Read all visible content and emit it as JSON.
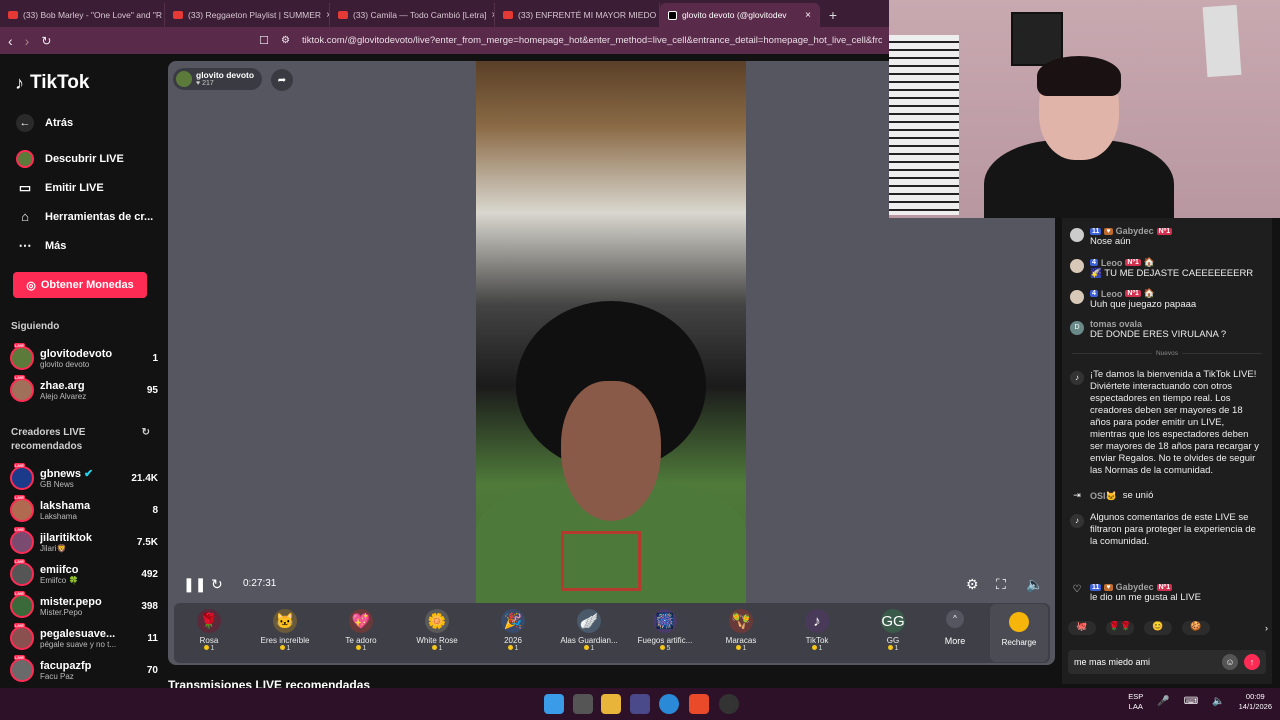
{
  "browser": {
    "tabs": [
      {
        "title": "(33) Bob Marley - \"One Love\" and \"R",
        "type": "youtube"
      },
      {
        "title": "(33) Reggaeton Playlist | SUMMER",
        "type": "youtube-muted"
      },
      {
        "title": "(33) Camila — Todo Cambió [Letra]",
        "type": "youtube"
      },
      {
        "title": "(33) ENFRENTÉ MI MAYOR MIEDO -",
        "type": "youtube"
      },
      {
        "title": "glovito devoto (@glovitodev",
        "type": "tiktok",
        "active": true
      }
    ],
    "url": "tiktok.com/@glovitodevoto/live?enter_from_merge=homepage_hot&enter_method=live_cell&entrance_detail=homepage_hot_live_cell&from"
  },
  "sidebar": {
    "brand": "TikTok",
    "nav": [
      {
        "label": "Atrás",
        "icon": "back-arrow-icon"
      },
      {
        "label": "Descubrir LIVE",
        "icon": "live-avatar-icon"
      },
      {
        "label": "Emitir LIVE",
        "icon": "camera-icon"
      },
      {
        "label": "Herramientas de cr...",
        "icon": "home-icon"
      },
      {
        "label": "Más",
        "icon": "more-icon"
      }
    ],
    "coins_button": "Obtener Monedas",
    "following_title": "Siguiendo",
    "following": [
      {
        "name": "glovitodevoto",
        "sub": "glovito devoto",
        "count": "1",
        "color": "#5c7b3a"
      },
      {
        "name": "zhae.arg",
        "sub": "Alejo Alvarez",
        "count": "95",
        "color": "#a0705a"
      }
    ],
    "recommended_title": "Creadores LIVE recomendados",
    "recommended": [
      {
        "name": "gbnews",
        "sub": "GB News",
        "count": "21.4K",
        "color": "#1c3a8a",
        "verified": true
      },
      {
        "name": "lakshama",
        "sub": "Lakshama",
        "count": "8",
        "color": "#b06a50"
      },
      {
        "name": "jilaritiktok",
        "sub": "Jilari🦁",
        "count": "7.5K",
        "color": "#7a4a70"
      },
      {
        "name": "emiifco",
        "sub": "Emiifco 🍀",
        "count": "492",
        "color": "#555"
      },
      {
        "name": "mister.pepo",
        "sub": "Mister.Pepo",
        "count": "398",
        "color": "#3a6a3a"
      },
      {
        "name": "pegalesuave...",
        "sub": "pégale suave y no t...",
        "count": "11",
        "color": "#8a5050"
      },
      {
        "name": "facupazfp",
        "sub": "Facu Paz",
        "count": "70",
        "color": "#6a6a6a"
      }
    ]
  },
  "player": {
    "host_name": "glovito devoto",
    "host_likes": "217",
    "elapsed": "0:27:31"
  },
  "gifts": [
    {
      "name": "Rosa",
      "price": "1",
      "icon": "🌹",
      "bg": "#5a2a3a"
    },
    {
      "name": "Eres increíble",
      "price": "1",
      "icon": "🐱",
      "bg": "#6a5a3a"
    },
    {
      "name": "Te adoro",
      "price": "1",
      "icon": "💖",
      "bg": "#6a3a3a"
    },
    {
      "name": "White Rose",
      "price": "1",
      "icon": "🌼",
      "bg": "#5a5a5a"
    },
    {
      "name": "2026",
      "price": "1",
      "icon": "🎉",
      "bg": "#3a4a6a"
    },
    {
      "name": "Alas Guardian...",
      "price": "1",
      "icon": "🪽",
      "bg": "#4a5a6a"
    },
    {
      "name": "Fuegos artific...",
      "price": "5",
      "icon": "🎆",
      "bg": "#4a3a6a"
    },
    {
      "name": "Maracas",
      "price": "1",
      "icon": "🪇",
      "bg": "#6a3a3a"
    },
    {
      "name": "TikTok",
      "price": "1",
      "icon": "♪",
      "bg": "#4a3a5a"
    },
    {
      "name": "GG",
      "price": "1",
      "icon": "GG",
      "bg": "#3a5a4a"
    }
  ],
  "more_label": "More",
  "recharge_label": "Recharge",
  "recommended_section": "Transmisiones LIVE recomendadas",
  "chat": {
    "messages": [
      {
        "name": "Gabydec",
        "badges": [
          "11",
          "♥",
          "Nº1"
        ],
        "text": "Nose aún",
        "color": "#ccc"
      },
      {
        "name": "Leoo",
        "badges": [
          "4",
          "Nº1",
          "🏠"
        ],
        "text": "🌠 TU ME DEJASTE CAEEEEEEERR",
        "color": "#d8c8b8"
      },
      {
        "name": "Leoo",
        "badges": [
          "4",
          "Nº1",
          "🏠"
        ],
        "text": "Uuh que juegazo papaaa",
        "color": "#d8c8b8"
      },
      {
        "name": "tomas ovala",
        "badges": [],
        "text": "DE DONDE ERES VIRULANA ?",
        "color": "#6a8a8a",
        "initial": "D"
      }
    ],
    "divider": "Nuevos",
    "welcome": "¡Te damos la bienvenida a TikTok LIVE! Diviértete interactuando con otros espectadores en tiempo real. Los creadores deben ser mayores de 18 años para poder emitir un LIVE, mientras que los espectadores deben ser mayores de 18 años para recargar y enviar Regalos. No te olvides de seguir las Normas de la comunidad.",
    "joined_user": "OSI🐱",
    "joined_text": "se unió",
    "filter_notice": "Algunos comentarios de este LIVE se filtraron para proteger la experiencia de la comunidad.",
    "like_user": "Gabydec",
    "like_text": "le dio un me gusta al LIVE",
    "input_value": "me mas miedo ami"
  },
  "taskbar": {
    "lang": "ESP",
    "lang2": "LAA",
    "time": "00:09",
    "date": "14/1/2026"
  }
}
